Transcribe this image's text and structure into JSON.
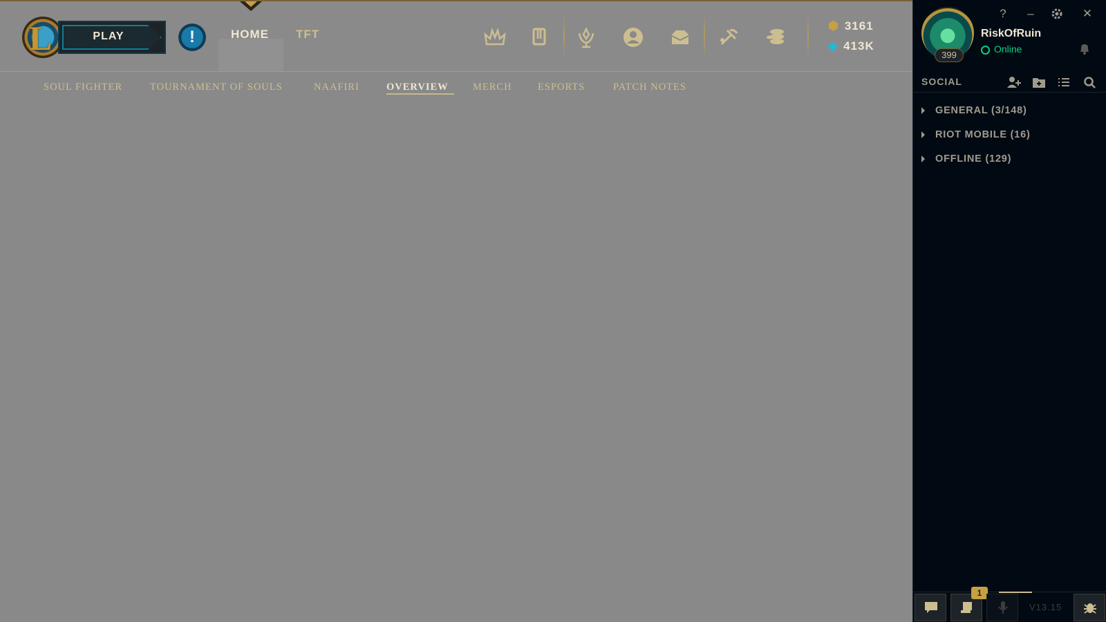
{
  "header": {
    "play_label": "PLAY",
    "tabs": [
      {
        "label": "HOME",
        "active": true
      },
      {
        "label": "TFT",
        "active": false
      }
    ],
    "icons": [
      "champions-crest-icon",
      "collection-icon",
      "ranked-trophy-icon",
      "profile-icon",
      "loot-chest-icon",
      "crafting-hammer-icon",
      "store-coins-icon"
    ],
    "currency": {
      "rp": "3161",
      "blue_essence": "413K"
    }
  },
  "subnav": {
    "items": [
      {
        "label": "SOUL FIGHTER",
        "active": false
      },
      {
        "label": "TOURNAMENT OF SOULS",
        "active": false
      },
      {
        "label": "NAAFIRI",
        "active": false
      },
      {
        "label": "OVERVIEW",
        "active": true
      },
      {
        "label": "MERCH",
        "active": false
      },
      {
        "label": "ESPORTS",
        "active": false
      },
      {
        "label": "PATCH NOTES",
        "active": false
      }
    ]
  },
  "profile": {
    "level": "399",
    "username": "RiskOfRuin",
    "status": "Online"
  },
  "window_controls": {
    "help": "?",
    "minimize": "–",
    "close": "✕"
  },
  "social": {
    "title": "SOCIAL",
    "groups": [
      {
        "label": "GENERAL (3/148)"
      },
      {
        "label": "RIOT MOBILE (16)"
      },
      {
        "label": "OFFLINE (129)"
      }
    ]
  },
  "bottom_bar": {
    "notification_count": "1",
    "version": "V13.15"
  },
  "colors": {
    "gold": "#cdbe91",
    "gold_dark": "#785a28",
    "sidebar_bg": "#010a13",
    "main_bg": "#898989",
    "online_green": "#0acf83",
    "rp_blue": "#22b8d6"
  }
}
